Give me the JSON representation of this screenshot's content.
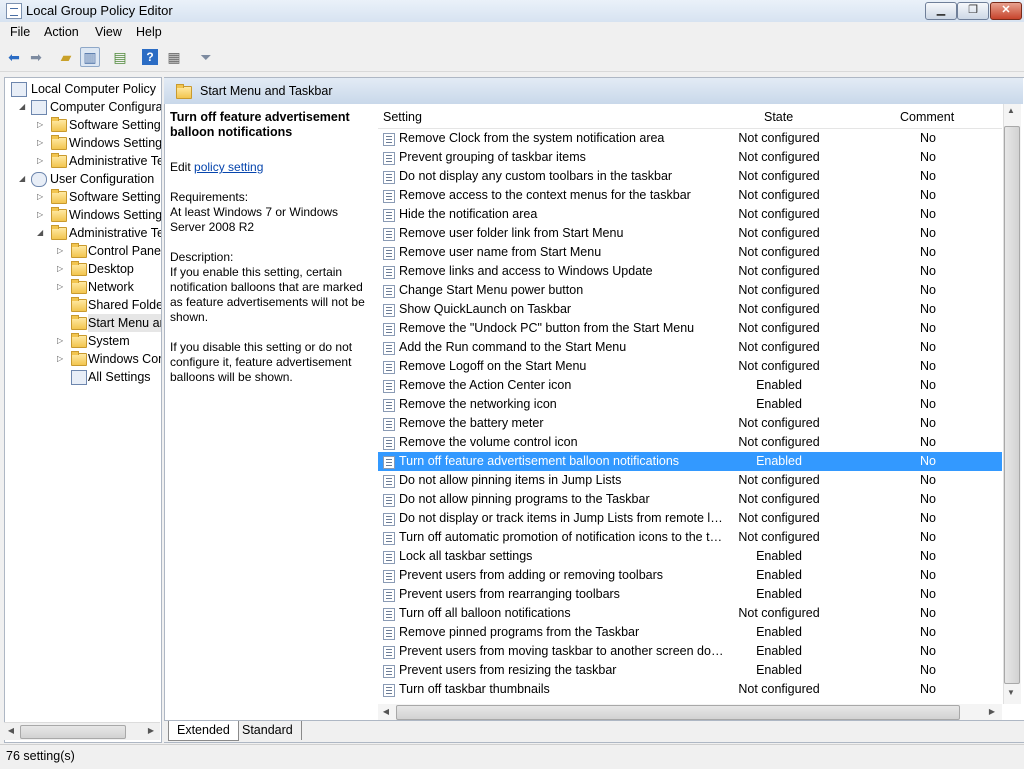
{
  "window": {
    "title": "Local Group Policy Editor",
    "min": "▁",
    "max": "❐",
    "close": "✕"
  },
  "menu": [
    "File",
    "Action",
    "View",
    "Help"
  ],
  "tree": [
    {
      "label": "Local Computer Policy",
      "icon": "computer-icon",
      "arrow": ""
    },
    {
      "label": "Computer Configuration",
      "icon": "computer-icon",
      "arrow": "◢"
    },
    {
      "label": "Software Settings",
      "icon": "folder-icon",
      "arrow": "▷"
    },
    {
      "label": "Windows Settings",
      "icon": "folder-icon",
      "arrow": "▷"
    },
    {
      "label": "Administrative Templates",
      "icon": "folder-icon",
      "arrow": "▷"
    },
    {
      "label": "User Configuration",
      "icon": "user-icon",
      "arrow": "◢"
    },
    {
      "label": "Software Settings",
      "icon": "folder-icon",
      "arrow": "▷"
    },
    {
      "label": "Windows Settings",
      "icon": "folder-icon",
      "arrow": "▷"
    },
    {
      "label": "Administrative Templates",
      "icon": "folder-icon",
      "arrow": "◢"
    },
    {
      "label": "Control Panel",
      "icon": "folder-icon",
      "arrow": "▷"
    },
    {
      "label": "Desktop",
      "icon": "folder-icon",
      "arrow": "▷"
    },
    {
      "label": "Network",
      "icon": "folder-icon",
      "arrow": "▷"
    },
    {
      "label": "Shared Folders",
      "icon": "folder-icon",
      "arrow": ""
    },
    {
      "label": "Start Menu and Taskbar",
      "icon": "folder-icon",
      "arrow": ""
    },
    {
      "label": "System",
      "icon": "folder-icon",
      "arrow": "▷"
    },
    {
      "label": "Windows Components",
      "icon": "folder-icon",
      "arrow": "▷"
    },
    {
      "label": "All Settings",
      "icon": "settings-icon",
      "arrow": ""
    }
  ],
  "right_header": {
    "title": "Start Menu and Taskbar"
  },
  "description": {
    "title": "Turn off feature advertisement balloon notifications",
    "edit_prefix": "Edit ",
    "edit_link": "policy setting",
    "requirements_label": "Requirements:",
    "requirements": "At least Windows 7 or Windows Server 2008 R2",
    "description_label": "Description:",
    "p1": "If you enable this setting, certain notification balloons that are marked as feature advertisements will not be shown.",
    "p2": "If you disable this setting or do not configure it, feature advertisement balloons will be shown."
  },
  "columns": {
    "setting": "Setting",
    "state": "State",
    "comment": "Comment"
  },
  "rows": [
    {
      "name": "Remove Clock from the system notification area",
      "state": "Not configured",
      "comment": "No"
    },
    {
      "name": "Prevent grouping of taskbar items",
      "state": "Not configured",
      "comment": "No"
    },
    {
      "name": "Do not display any custom toolbars in the taskbar",
      "state": "Not configured",
      "comment": "No"
    },
    {
      "name": "Remove access to the context menus for the taskbar",
      "state": "Not configured",
      "comment": "No"
    },
    {
      "name": "Hide the notification area",
      "state": "Not configured",
      "comment": "No"
    },
    {
      "name": "Remove user folder link from Start Menu",
      "state": "Not configured",
      "comment": "No"
    },
    {
      "name": "Remove user name from Start Menu",
      "state": "Not configured",
      "comment": "No"
    },
    {
      "name": "Remove links and access to Windows Update",
      "state": "Not configured",
      "comment": "No"
    },
    {
      "name": "Change Start Menu power button",
      "state": "Not configured",
      "comment": "No"
    },
    {
      "name": "Show QuickLaunch on Taskbar",
      "state": "Not configured",
      "comment": "No"
    },
    {
      "name": "Remove the \"Undock PC\" button from the Start Menu",
      "state": "Not configured",
      "comment": "No"
    },
    {
      "name": "Add the Run command to the Start Menu",
      "state": "Not configured",
      "comment": "No"
    },
    {
      "name": "Remove Logoff on the Start Menu",
      "state": "Not configured",
      "comment": "No"
    },
    {
      "name": "Remove the Action Center icon",
      "state": "Enabled",
      "comment": "No"
    },
    {
      "name": "Remove the networking icon",
      "state": "Enabled",
      "comment": "No"
    },
    {
      "name": "Remove the battery meter",
      "state": "Not configured",
      "comment": "No"
    },
    {
      "name": "Remove the volume control icon",
      "state": "Not configured",
      "comment": "No"
    },
    {
      "name": "Turn off feature advertisement balloon notifications",
      "state": "Enabled",
      "comment": "No",
      "selected": true
    },
    {
      "name": "Do not allow pinning items in Jump Lists",
      "state": "Not configured",
      "comment": "No"
    },
    {
      "name": "Do not allow pinning programs to the Taskbar",
      "state": "Not configured",
      "comment": "No"
    },
    {
      "name": "Do not display or track items in Jump Lists from remote locations",
      "state": "Not configured",
      "comment": "No"
    },
    {
      "name": "Turn off automatic promotion of notification icons to the taskbar",
      "state": "Not configured",
      "comment": "No"
    },
    {
      "name": "Lock all taskbar settings",
      "state": "Enabled",
      "comment": "No"
    },
    {
      "name": "Prevent users from adding or removing toolbars",
      "state": "Enabled",
      "comment": "No"
    },
    {
      "name": "Prevent users from rearranging toolbars",
      "state": "Enabled",
      "comment": "No"
    },
    {
      "name": "Turn off all balloon notifications",
      "state": "Not configured",
      "comment": "No"
    },
    {
      "name": "Remove pinned programs from the Taskbar",
      "state": "Enabled",
      "comment": "No"
    },
    {
      "name": "Prevent users from moving taskbar to another screen dock location",
      "state": "Enabled",
      "comment": "No"
    },
    {
      "name": "Prevent users from resizing the taskbar",
      "state": "Enabled",
      "comment": "No"
    },
    {
      "name": "Turn off taskbar thumbnails",
      "state": "Not configured",
      "comment": "No"
    }
  ],
  "tabs": {
    "extended": "Extended",
    "standard": "Standard"
  },
  "status": "76 setting(s)",
  "colors": {
    "selection": "#3399ff",
    "header": "#c9d8ea",
    "link": "#0645ad"
  }
}
